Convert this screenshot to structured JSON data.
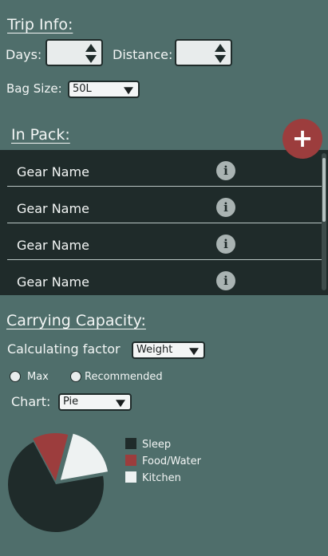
{
  "trip_info": {
    "heading": "Trip Info:",
    "days_label": "Days:",
    "days_value": "",
    "distance_label": "Distance:",
    "distance_value": "",
    "bag_size_label": "Bag Size:",
    "bag_size_value": "50L"
  },
  "in_pack": {
    "heading": "In Pack:",
    "add_label": "+",
    "items": [
      {
        "name": "Gear Name",
        "info": "i"
      },
      {
        "name": "Gear Name",
        "info": "i"
      },
      {
        "name": "Gear Name",
        "info": "i"
      },
      {
        "name": "Gear Name",
        "info": "i"
      }
    ]
  },
  "carrying": {
    "heading": "Carrying Capacity:",
    "factor_label": "Calculating factor",
    "factor_value": "Weight",
    "radio_max": "Max",
    "radio_recommended": "Recommended",
    "chart_label": "Chart:",
    "chart_value": "Pie"
  },
  "colors": {
    "background": "#4f6e6b",
    "dark": "#1f2b2a",
    "accent": "#9c3d3d",
    "light": "#eef2f2"
  },
  "chart_data": {
    "type": "pie",
    "title": "",
    "categories": [
      "Sleep",
      "Food/Water",
      "Kitchen"
    ],
    "values": [
      70,
      12,
      18
    ],
    "colors": [
      "#1f2b2a",
      "#9c3d3d",
      "#eef2f2"
    ],
    "legend": "right"
  }
}
